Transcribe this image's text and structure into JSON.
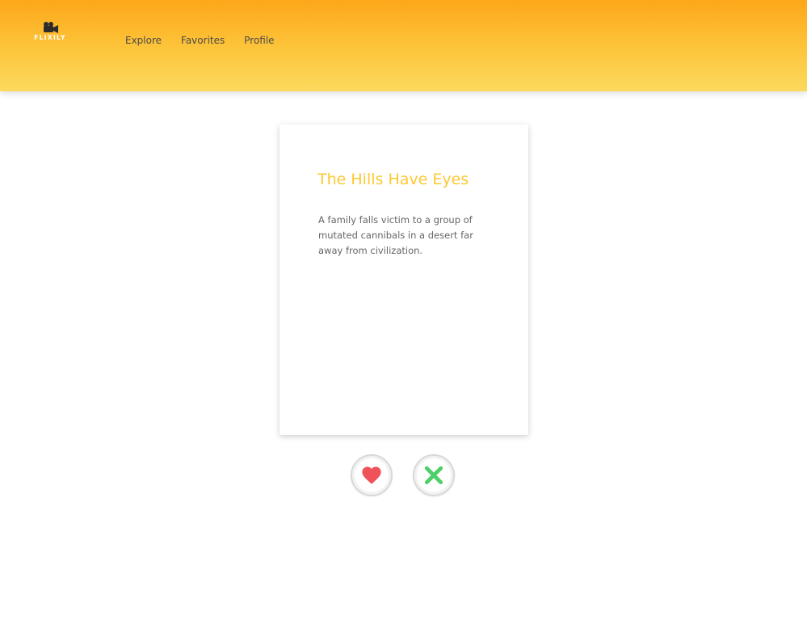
{
  "brand": {
    "logo_text": "FLIXILY",
    "logo_icon": "movie-camera-icon"
  },
  "nav": {
    "items": [
      {
        "label": "Explore"
      },
      {
        "label": "Favorites"
      },
      {
        "label": "Profile"
      }
    ]
  },
  "movie": {
    "title": "The Hills Have Eyes",
    "description": "A family falls victim to a group of mutated cannibals in a desert far away from civilization."
  },
  "actions": {
    "like_icon": "heart-icon",
    "dislike_icon": "close-icon"
  },
  "colors": {
    "header_gradient_top": "#fda719",
    "header_gradient_bottom": "#fcd95e",
    "title_accent": "#fcc832",
    "like": "#f0525a",
    "dislike": "#4fcf6a"
  }
}
